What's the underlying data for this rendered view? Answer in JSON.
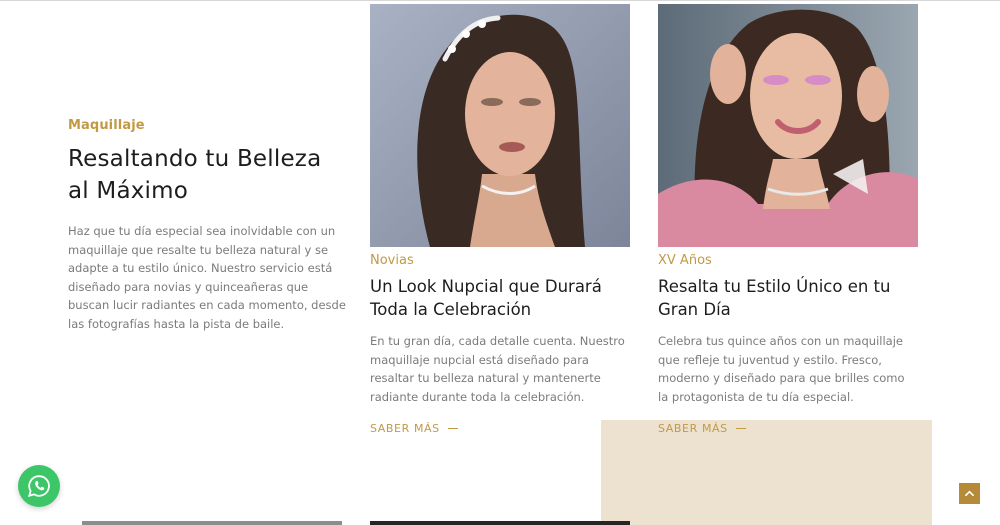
{
  "intro": {
    "category": "Maquillaje",
    "title": "Resaltando tu Belleza al Máximo",
    "description": "Haz que tu día especial sea inolvidable con un maquillaje que resalte tu belleza natural y se adapte a tu estilo único. Nuestro servicio está diseñado para novias y quinceañeras que buscan lucir radiantes en cada momento, desde las fotografías hasta la pista de baile."
  },
  "cards": [
    {
      "category": "Novias",
      "title": "Un Look Nupcial que Durará Toda la Celebración",
      "description": "En tu gran día, cada detalle cuenta. Nuestro maquillaje nupcial está diseñado para resaltar tu belleza natural y mantenerte radiante durante toda la celebración.",
      "link": "SABER MÁS"
    },
    {
      "category": "XV Años",
      "title": "Resalta tu Estilo Único en tu Gran Día",
      "description": "Celebra tus quince años con un maquillaje que refleje tu juventud y estilo. Fresco, moderno y diseñado para que brilles como la protagonista de tu día especial.",
      "link": "SABER MÁS"
    }
  ],
  "colors": {
    "accent": "#c29a45",
    "beige": "#ece2cf",
    "whatsapp": "#3cc667"
  },
  "icons": {
    "chat": "whatsapp-icon",
    "scroll_top": "chevron-up-icon"
  }
}
